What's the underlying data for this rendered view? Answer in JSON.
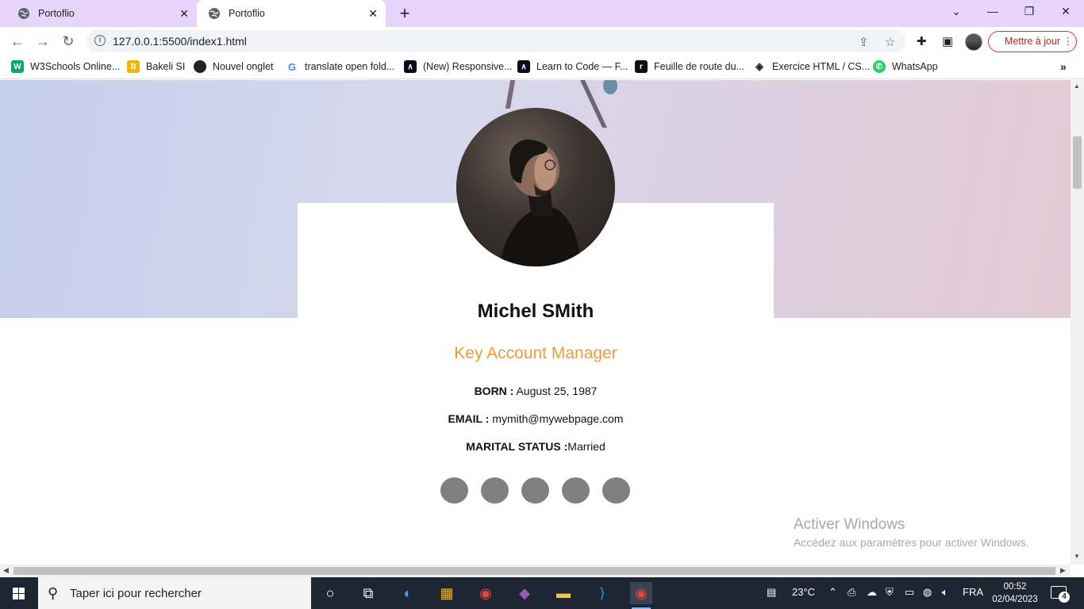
{
  "tabs": [
    {
      "title": "Portoflio",
      "state": "inactive"
    },
    {
      "title": "Portoflio",
      "state": "active"
    }
  ],
  "tab_close_glyph": "✕",
  "new_tab_glyph": "+",
  "window_controls": {
    "minimize": "—",
    "restore": "❐",
    "close": "✕",
    "tab_search": "⌄"
  },
  "omnibox": {
    "url": "127.0.0.1:5500/index1.html"
  },
  "update_button": {
    "label": "Mettre à jour"
  },
  "bookmarks": [
    {
      "label": "W3Schools Online...",
      "icon": "w3schools-icon",
      "color": "#04aa6d",
      "glyph": "W"
    },
    {
      "label": "Bakeli SI",
      "icon": "bakeli-icon",
      "color": "#f4b400",
      "glyph": "B"
    },
    {
      "label": "Nouvel onglet",
      "icon": "globe-icon",
      "color": "#202124",
      "glyph": "●"
    },
    {
      "label": "translate open fold...",
      "icon": "google-icon",
      "color": "#4285f4",
      "glyph": "G"
    },
    {
      "label": "(New) Responsive...",
      "icon": "freecodecamp-icon",
      "color": "#0a0a23",
      "glyph": "∧"
    },
    {
      "label": "Learn to Code — F...",
      "icon": "freecodecamp-icon",
      "color": "#0a0a23",
      "glyph": "∧"
    },
    {
      "label": "Feuille de route du...",
      "icon": "roadmap-icon",
      "color": "#111111",
      "glyph": "r"
    },
    {
      "label": "Exercice HTML / CS...",
      "icon": "codepen-icon",
      "color": "#ffffff",
      "glyph": "◈"
    },
    {
      "label": "WhatsApp",
      "icon": "whatsapp-icon",
      "color": "#25d366",
      "glyph": "✆"
    }
  ],
  "profile": {
    "name": "Michel SMith",
    "role": "Key Account Manager",
    "born_label": "BORN :",
    "born_value": " August 25, 1987",
    "email_label": "EMAIL :",
    "email_value": " mymith@mywebpage.com",
    "marital_label": "MARITAL STATUS :",
    "marital_value": "Married",
    "social_buttons": 5
  },
  "colors": {
    "accent_orange": "#f39a38",
    "tabstrip": "#e8d5fb",
    "update_red": "#c5221f",
    "social_grey": "#808080"
  },
  "watermark": {
    "title": "Activer Windows",
    "subtitle": "Accédez aux paramètres pour activer Windows."
  },
  "taskbar": {
    "search_placeholder": "Taper ici pour rechercher",
    "temperature": "23°C",
    "language": "FRA",
    "time": "00:52",
    "date": "02/04/2023",
    "notification_count": "4"
  }
}
